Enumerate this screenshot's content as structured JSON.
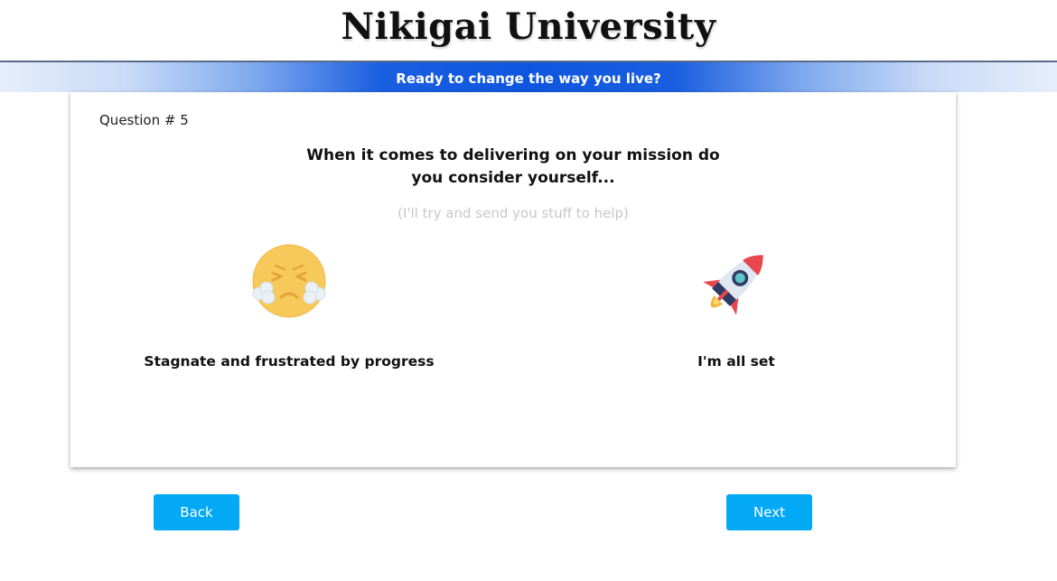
{
  "header": {
    "title": "Nikigai University"
  },
  "banner": {
    "text": "Ready to change the way you live?"
  },
  "question": {
    "number_label": "Question # 5",
    "text": "When it comes to delivering on your mission do you consider yourself...",
    "hint": "(I'll try and send you stuff to help)"
  },
  "options": [
    {
      "label": "Stagnate and frustrated by progress",
      "icon": "frustrated-face-icon"
    },
    {
      "label": "I'm all set",
      "icon": "rocket-icon"
    }
  ],
  "navigation": {
    "back_label": "Back",
    "next_label": "Next"
  },
  "colors": {
    "banner_blue": "#0f56df",
    "button_blue": "#03a9f4",
    "emoji_yellow": "#f7c85a",
    "rocket_red": "#e8474e"
  }
}
